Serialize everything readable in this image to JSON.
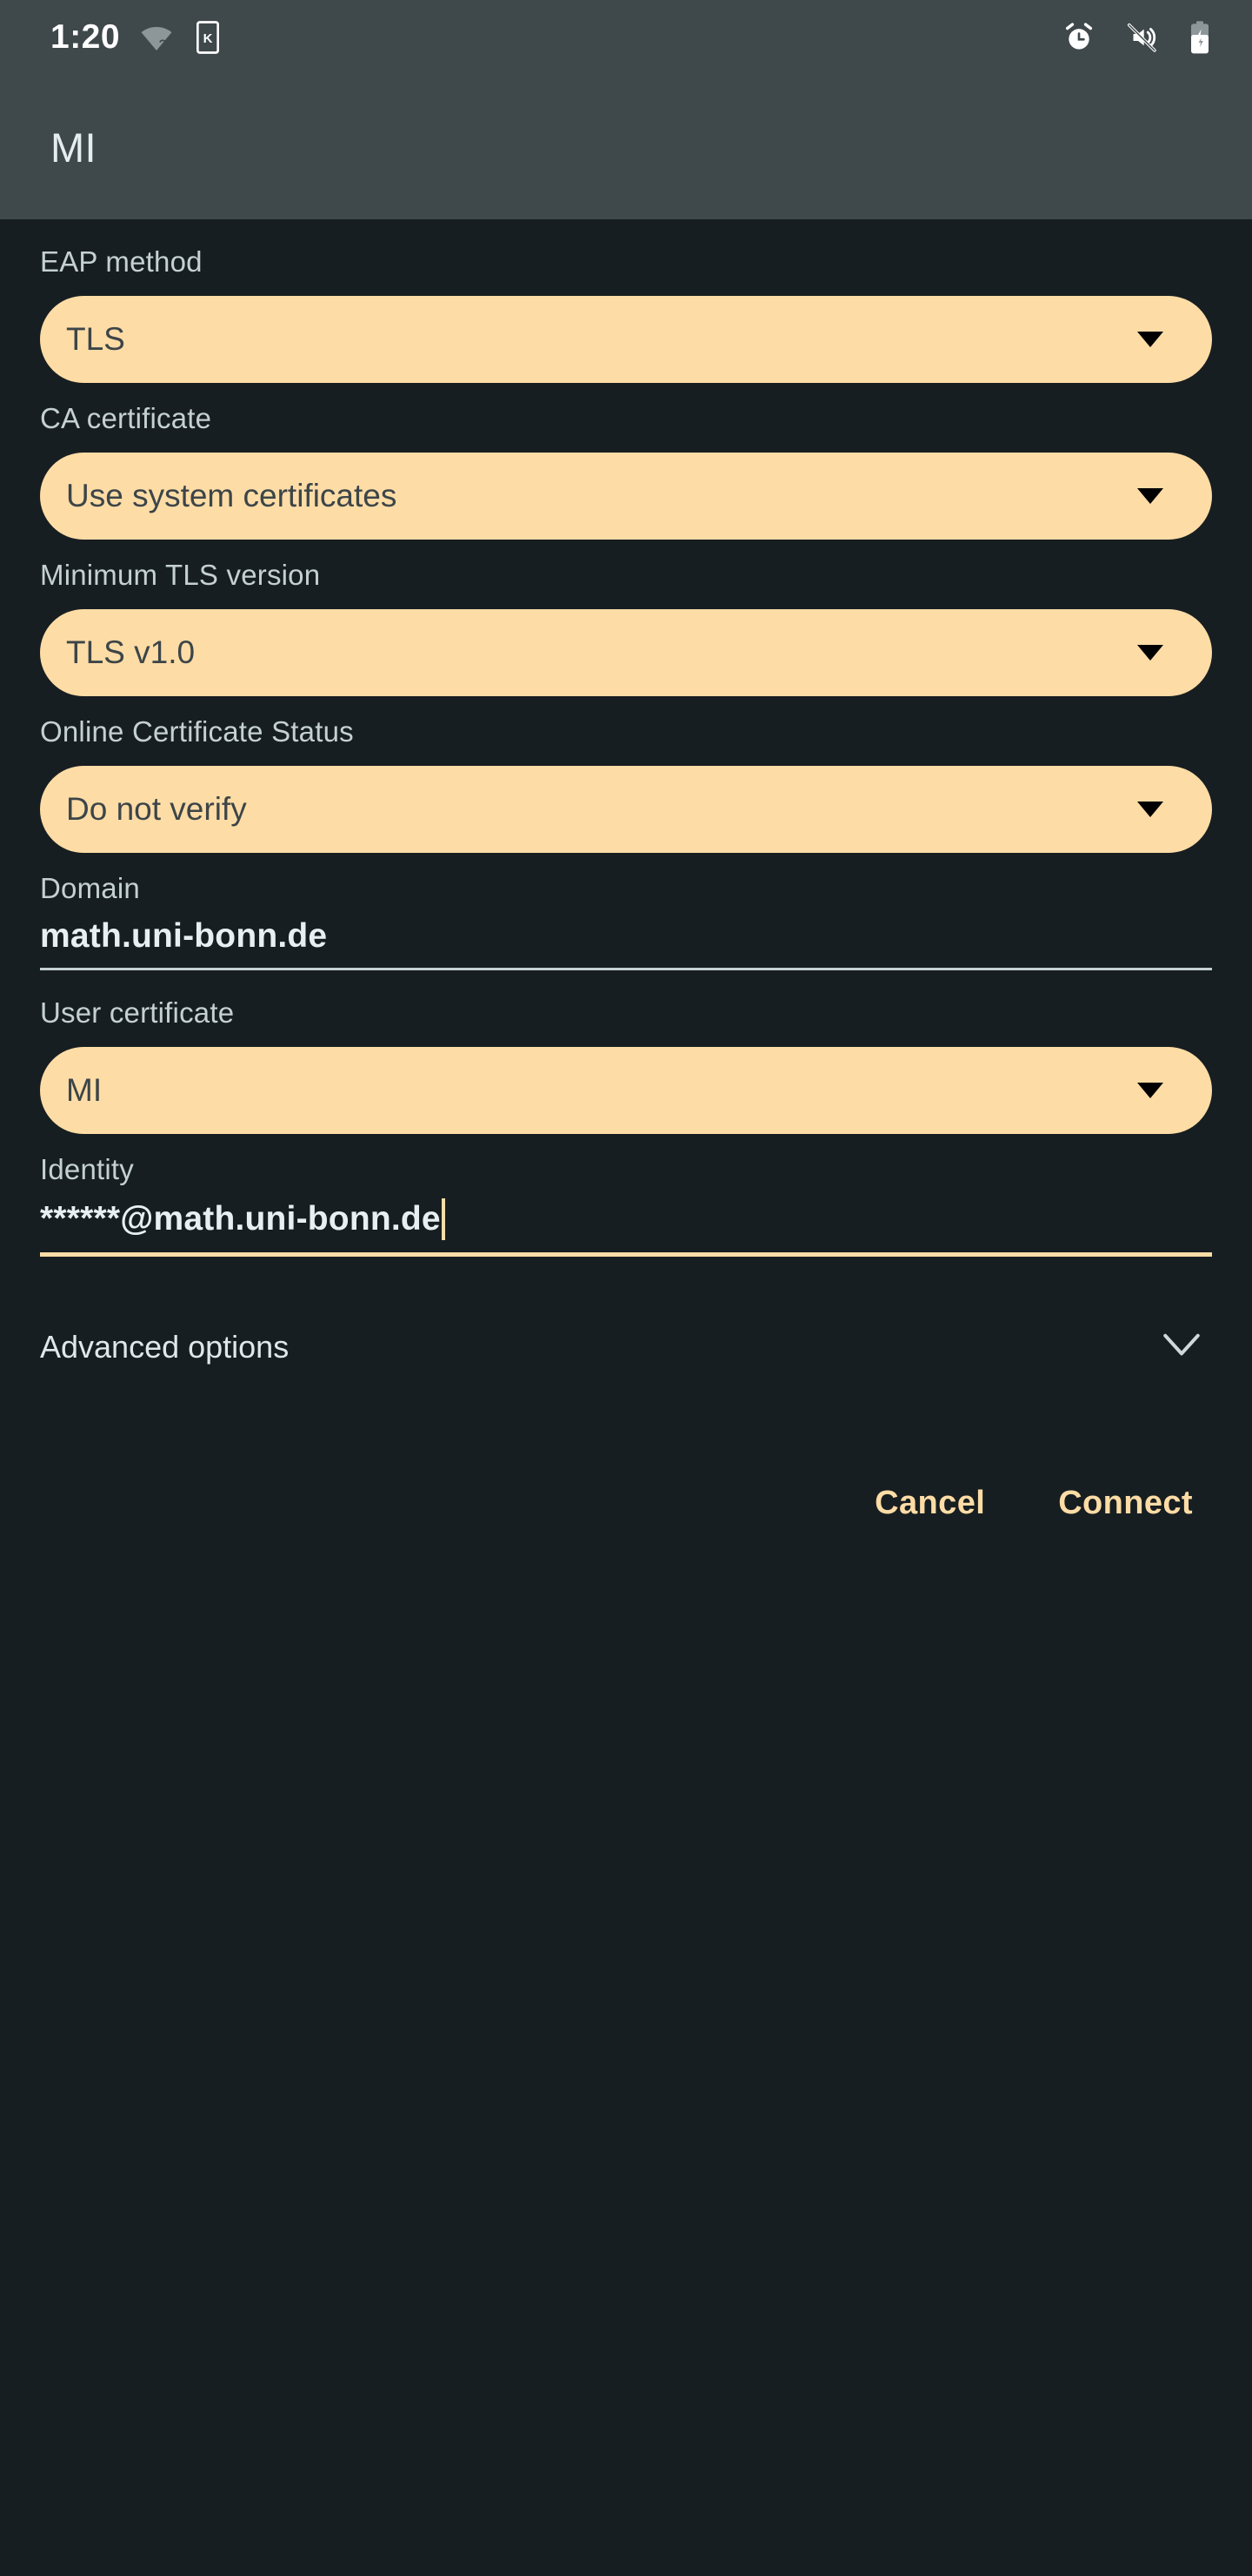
{
  "status_bar": {
    "time": "1:20",
    "icons_left": [
      "wifi-no-internet-icon",
      "sim-card-k-icon"
    ],
    "icons_right": [
      "alarm-icon",
      "vibrate-off-icon",
      "battery-charging-icon"
    ]
  },
  "app_bar": {
    "title": "MI"
  },
  "fields": [
    {
      "label": "EAP method",
      "value": "TLS",
      "type": "spinner"
    },
    {
      "label": "CA certificate",
      "value": "Use system certificates",
      "type": "spinner"
    },
    {
      "label": "Minimum TLS version",
      "value": "TLS v1.0",
      "type": "spinner"
    },
    {
      "label": "Online Certificate Status",
      "value": "Do not verify",
      "type": "spinner"
    },
    {
      "label": "Domain",
      "value": "math.uni-bonn.de",
      "type": "edittext"
    },
    {
      "label": "User certificate",
      "value": "MI",
      "type": "spinner"
    },
    {
      "label": "Identity",
      "value": "******@math.uni-bonn.de",
      "type": "edittext",
      "focused": true
    }
  ],
  "advanced": {
    "label": "Advanced options",
    "icon": "chevron-down-icon"
  },
  "buttons": {
    "cancel": "Cancel",
    "connect": "Connect"
  },
  "colors": {
    "background": "#171e21",
    "app_bar": "#3f484b",
    "accent": "#fedca6",
    "label": "#c4d0d3",
    "value_text": "#e8eff1",
    "spinner_text": "#3c4548"
  }
}
